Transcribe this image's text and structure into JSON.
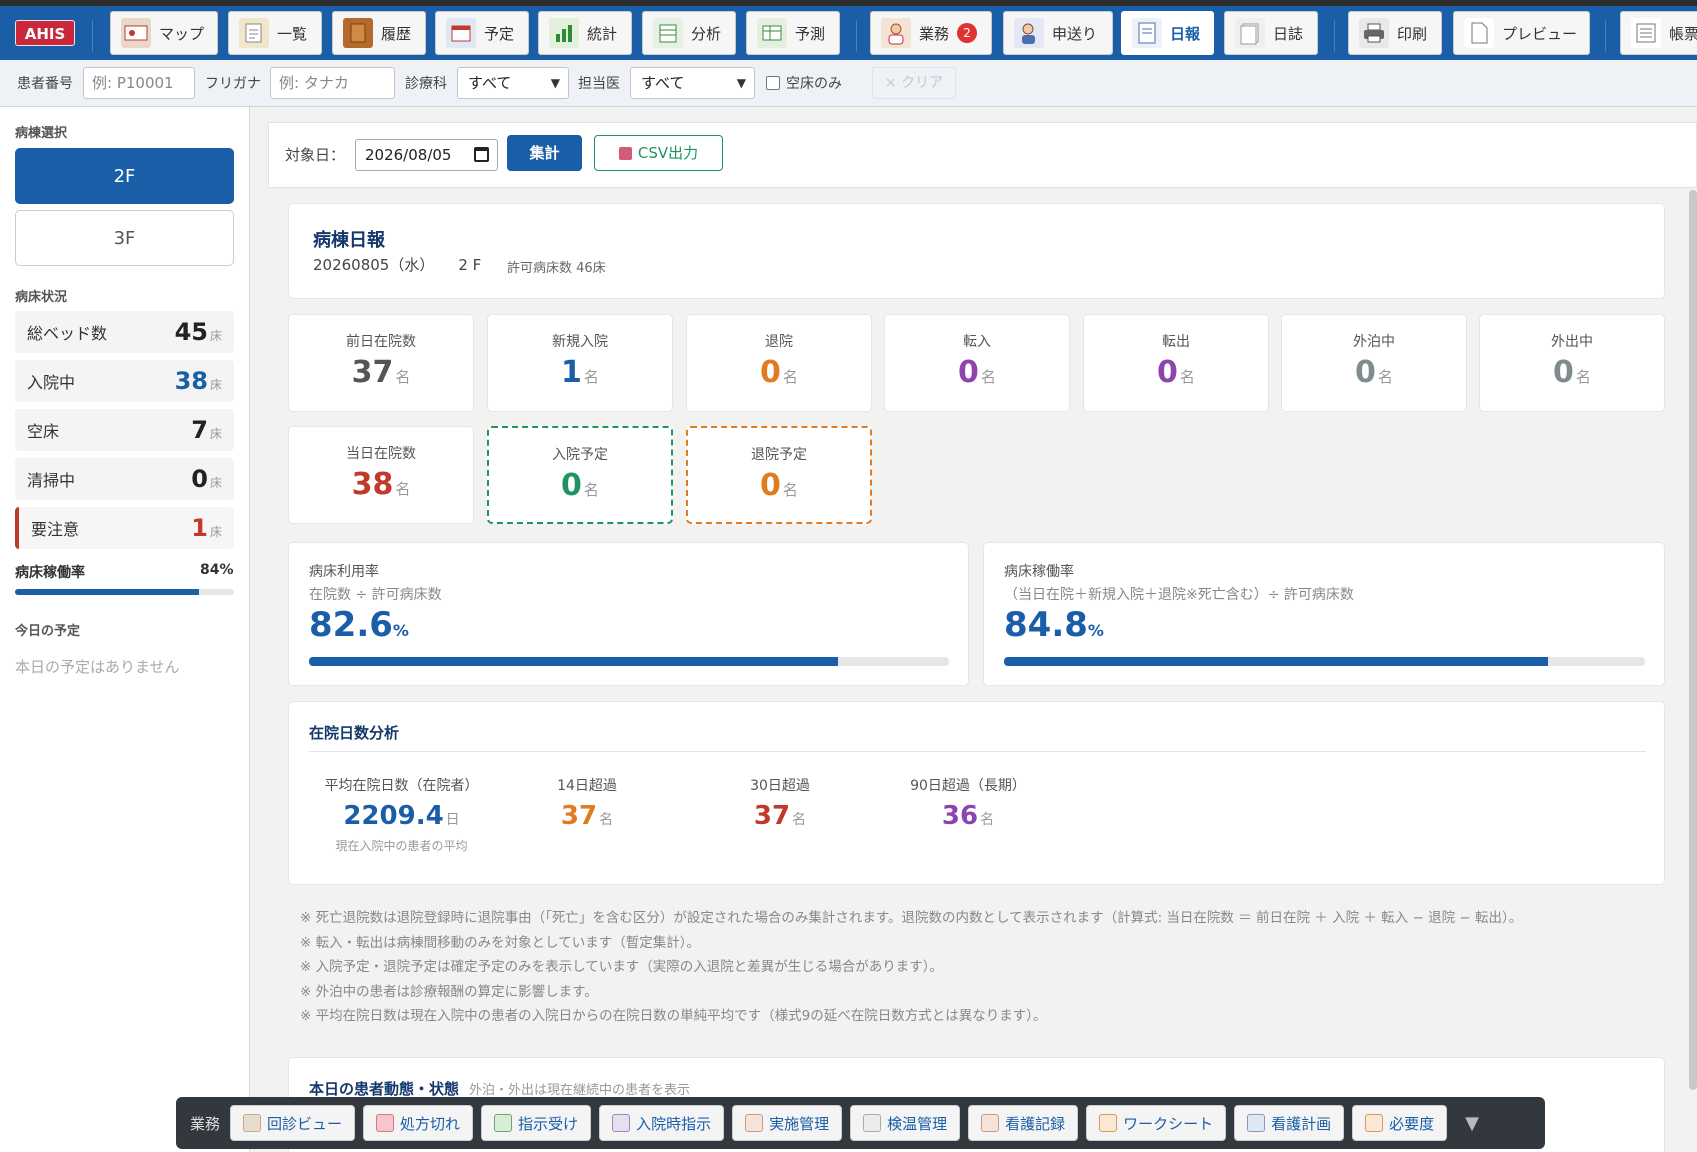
{
  "topbar": {
    "logo": "AHIS",
    "nav": [
      {
        "label": "マップ",
        "icon": "map-icon"
      },
      {
        "label": "一覧",
        "icon": "list-note-icon"
      },
      {
        "label": "履歴",
        "icon": "history-book-icon"
      },
      {
        "label": "予定",
        "icon": "schedule-icon"
      },
      {
        "label": "統計",
        "icon": "statistics-icon"
      },
      {
        "label": "分析",
        "icon": "analysis-icon"
      },
      {
        "label": "予測",
        "icon": "forecast-icon"
      },
      {
        "label": "業務",
        "icon": "nurse-icon",
        "badge": "2"
      },
      {
        "label": "申送り",
        "icon": "handover-icon"
      },
      {
        "label": "日報",
        "icon": "daily-report-icon",
        "active": true
      },
      {
        "label": "日誌",
        "icon": "journal-icon"
      },
      {
        "label": "印刷",
        "icon": "printer-icon"
      },
      {
        "label": "プレビュー",
        "icon": "preview-icon"
      },
      {
        "label": "帳票",
        "icon": "forms-icon"
      }
    ]
  },
  "filters": {
    "patient_no_label": "患者番号",
    "patient_no_placeholder": "例: P10001",
    "kana_label": "フリガナ",
    "kana_placeholder": "例: タナカ",
    "dept_label": "診療科",
    "dept_value": "すべて",
    "doctor_label": "担当医",
    "doctor_value": "すべて",
    "vacant_only_label": "空床のみ",
    "clear_label": "× クリア"
  },
  "sidebar": {
    "ward_select_title": "病棟選択",
    "wards": [
      "2F",
      "3F"
    ],
    "bed_status_title": "病床状況",
    "stats": [
      {
        "label": "総ベッド数",
        "value": "45",
        "unit": "床"
      },
      {
        "label": "入院中",
        "value": "38",
        "unit": "床"
      },
      {
        "label": "空床",
        "value": "7",
        "unit": "床"
      },
      {
        "label": "清掃中",
        "value": "0",
        "unit": "床"
      },
      {
        "label": "要注意",
        "value": "1",
        "unit": "床"
      }
    ],
    "occupancy_label": "病床稼働率",
    "occupancy_value": "84%",
    "occupancy_fraction": 0.84,
    "today_title": "今日の予定",
    "today_empty": "本日の予定はありません"
  },
  "toolbar": {
    "date_label": "対象日：",
    "date_value": "2026/08/05",
    "aggregate_label": "集計",
    "csv_label": "CSV出力"
  },
  "report": {
    "title": "病棟日報",
    "date": "20260805（水）",
    "ward": "2 F",
    "licensed_beds": "許可病床数 46床"
  },
  "kpis": [
    {
      "label": "前日在院数",
      "value": "37",
      "unit": "名"
    },
    {
      "label": "新規入院",
      "value": "1",
      "unit": "名"
    },
    {
      "label": "退院",
      "value": "0",
      "unit": "名"
    },
    {
      "label": "転入",
      "value": "0",
      "unit": "名"
    },
    {
      "label": "転出",
      "value": "0",
      "unit": "名"
    },
    {
      "label": "外泊中",
      "value": "0",
      "unit": "名"
    },
    {
      "label": "外出中",
      "value": "0",
      "unit": "名"
    },
    {
      "label": "当日在院数",
      "value": "38",
      "unit": "名"
    },
    {
      "label": "入院予定",
      "value": "0",
      "unit": "名"
    },
    {
      "label": "退院予定",
      "value": "0",
      "unit": "名"
    }
  ],
  "rates": [
    {
      "title": "病床利用率",
      "formula": "在院数 ÷ 許可病床数",
      "value": "82.6",
      "unit": "%",
      "fraction": 0.826
    },
    {
      "title": "病床稼働率",
      "formula": "（当日在院＋新規入院＋退院※死亡含む）÷ 許可病床数",
      "value": "84.8",
      "unit": "%",
      "fraction": 0.848
    }
  ],
  "los": {
    "title": "在院日数分析",
    "items": [
      {
        "label": "平均在院日数（在院者）",
        "value": "2209.4",
        "unit": "日",
        "note": "現在入院中の患者の平均"
      },
      {
        "label": "14日超過",
        "value": "37",
        "unit": "名"
      },
      {
        "label": "30日超過",
        "value": "37",
        "unit": "名"
      },
      {
        "label": "90日超過（長期）",
        "value": "36",
        "unit": "名"
      }
    ]
  },
  "notes": [
    "※ 死亡退院数は退院登録時に退院事由（「死亡」を含む区分）が設定された場合のみ集計されます。退院数の内数として表示されます（計算式: 当日在院数 ＝ 前日在院 ＋ 入院 ＋ 転入 − 退院 − 転出）。",
    "※ 転入・転出は病棟間移動のみを対象としています（暫定集計）。",
    "※ 入院予定・退院予定は確定予定のみを表示しています（実際の入退院と差異が生じる場合があります）。",
    "※ 外泊中の患者は診療報酬の算定に影響します。",
    "※ 平均在院日数は現在入院中の患者の入院日からの在院日数の単純平均です（様式9の延べ在院日数方式とは異なります）。"
  ],
  "movements": {
    "title": "本日の患者動態・状態",
    "subtitle": "外泊・外出は現在継続中の患者を表示"
  },
  "bottombar": {
    "label": "業務",
    "buttons": [
      "回診ビュー",
      "処方切れ",
      "指示受け",
      "入院時指示",
      "実施管理",
      "検温管理",
      "看護記録",
      "ワークシート",
      "看護計画",
      "必要度"
    ],
    "toggle": "▼"
  }
}
